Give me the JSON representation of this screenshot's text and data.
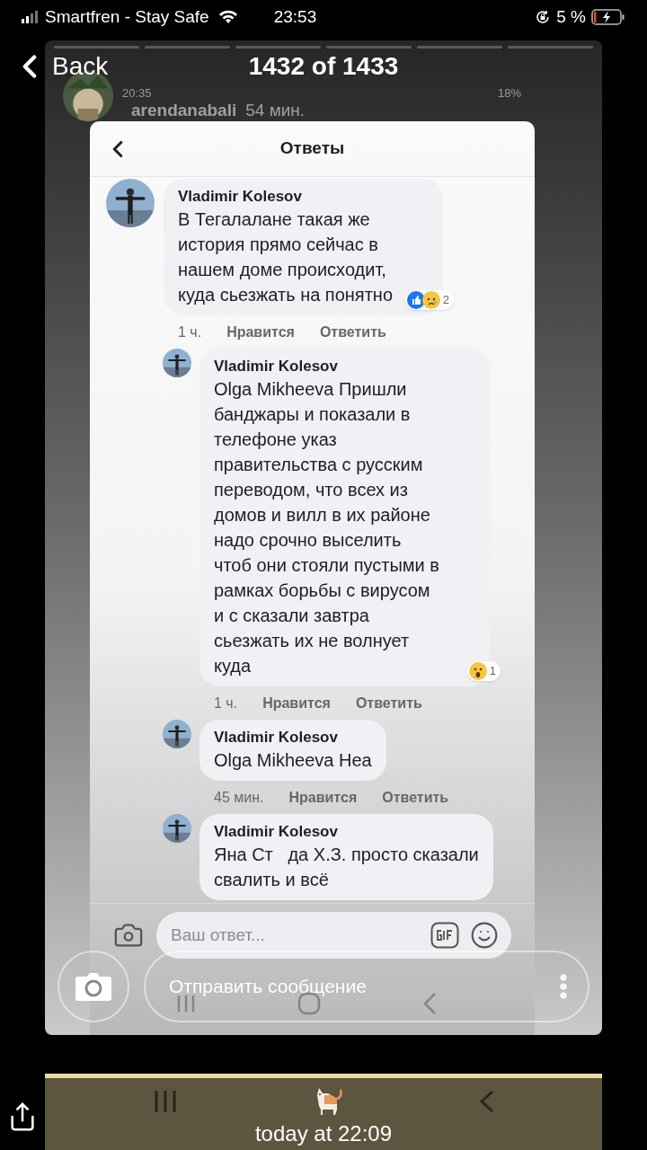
{
  "status_bar": {
    "carrier": "Smartfren - Stay Safe",
    "time": "23:53",
    "battery": "5 %"
  },
  "nav": {
    "back": "Back",
    "title": "1432 of 1433"
  },
  "story_header": {
    "clock": "20:35",
    "username": "arendanabali",
    "age": "54 мин.",
    "battery": "18%"
  },
  "replies_panel": {
    "title": "Ответы",
    "comments": [
      {
        "kind": "comment",
        "author": "Vladimir Kolesov",
        "lines": [
          "В Тегалалане такая же",
          "история прямо сейчас в",
          "нашем доме происходит,",
          "куда сьезжать на понятно"
        ],
        "time": "1 ч.",
        "like": "Нравится",
        "reply": "Ответить",
        "reaction_count": "2"
      },
      {
        "kind": "reply",
        "author": "Vladimir Kolesov",
        "lines": [
          "Olga Mikheeva Пришли",
          "банджары и показали в",
          "телефоне указ",
          "правительства с русским",
          "переводом, что всех из",
          "домов и вилл в их районе",
          "надо срочно выселить",
          "чтоб они стояли пустыми в",
          "рамках борьбы с вирусом",
          "и с сказали завтра",
          "сьезжать их не волнует",
          "куда"
        ],
        "time": "1 ч.",
        "like": "Нравится",
        "reply": "Ответить",
        "reaction_count": "1"
      },
      {
        "kind": "reply",
        "author": "Vladimir Kolesov",
        "lines": [
          "Olga Mikheeva Нea"
        ],
        "time": "45 мин.",
        "like": "Нравится",
        "reply": "Ответить"
      },
      {
        "kind": "reply",
        "author": "Vladimir Kolesov",
        "lines": [
          "Яна Ст   да Х.З. просто сказали",
          "свалить и всё"
        ]
      }
    ],
    "reply_field": {
      "placeholder": "Ваш ответ..."
    }
  },
  "message_bar": {
    "placeholder": "Отправить сообщение"
  },
  "footer": {
    "timestamp": "today at 22:09"
  }
}
